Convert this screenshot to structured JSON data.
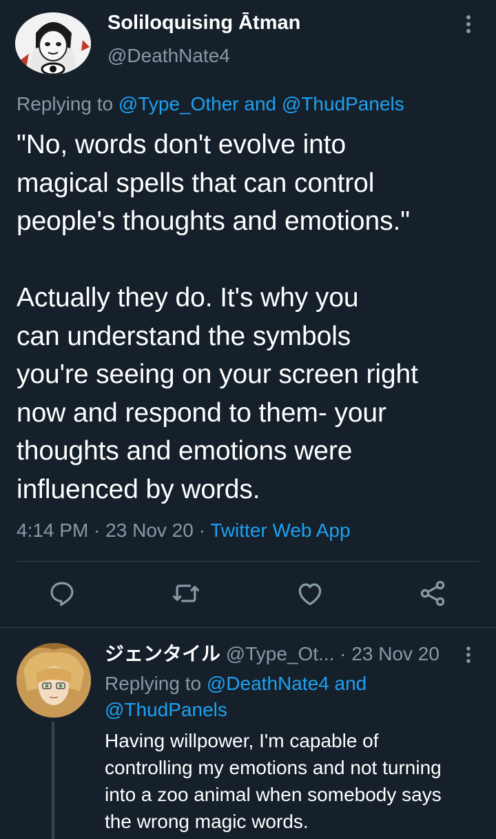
{
  "main_tweet": {
    "display_name": "Soliloquising Ātman",
    "handle": "@DeathNate4",
    "replying_prefix": "Replying to ",
    "replying_to_1": "@Type_Other",
    "replying_and": " and ",
    "replying_to_2": "@ThudPanels",
    "text_lines": [
      "\"No, words don't evolve into",
      "magical spells that can control",
      "people's thoughts and emotions.\"",
      "",
      "Actually they do. It's why you",
      "can understand the symbols",
      "you're seeing on your screen right",
      "now and respond to them- your",
      "thoughts and emotions were",
      "influenced by words."
    ],
    "time": "4:14 PM",
    "date": "23 Nov 20",
    "separator": " · ",
    "source": "Twitter Web App"
  },
  "actions": {
    "reply_icon": "reply-icon",
    "retweet_icon": "retweet-icon",
    "like_icon": "heart-icon",
    "share_icon": "share-icon"
  },
  "reply_tweet": {
    "display_name": "ジェンタイル",
    "handle": "@Type_Ot...",
    "separator": " · ",
    "date": "23 Nov 20",
    "replying_prefix": "Replying to ",
    "replying_to_1": "@DeathNate4",
    "replying_and": " and",
    "replying_to_2": "@ThudPanels",
    "text_lines": [
      "Having willpower, I'm capable of",
      "controlling my emotions and not turning",
      "into a zoo animal when somebody says",
      "the wrong magic words."
    ]
  },
  "colors": {
    "background": "#15202b",
    "text_primary": "#ffffff",
    "text_secondary": "#8899a6",
    "accent": "#1da1f2",
    "divider": "#38444d"
  }
}
